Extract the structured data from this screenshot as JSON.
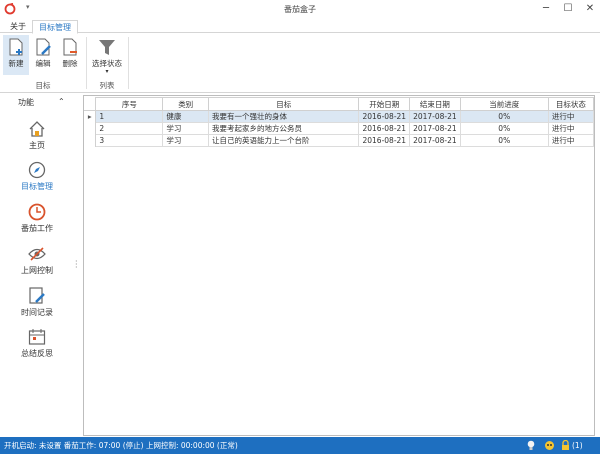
{
  "window": {
    "title": "番茄盒子",
    "minimize": "─",
    "maximize": "☐",
    "close": "✕",
    "quick_access": "▾"
  },
  "tabs": [
    {
      "label": "关于"
    },
    {
      "label": "目标管理",
      "active": true
    }
  ],
  "ribbon": {
    "groups": [
      {
        "label": "目标",
        "buttons": [
          {
            "label": "新建",
            "icon": "new-document-icon",
            "active": true
          },
          {
            "label": "编辑",
            "icon": "edit-document-icon"
          },
          {
            "label": "删除",
            "icon": "delete-document-icon"
          }
        ]
      },
      {
        "label": "列表",
        "buttons": [
          {
            "label": "选择状态",
            "icon": "filter-icon",
            "dropdown": "▾"
          }
        ]
      }
    ]
  },
  "sidebar": {
    "title": "功能",
    "collapse": "⌃",
    "items": [
      {
        "label": "主页",
        "icon": "home-icon"
      },
      {
        "label": "目标管理",
        "icon": "compass-icon",
        "active": true
      },
      {
        "label": "番茄工作",
        "icon": "clock-icon"
      },
      {
        "label": "上网控制",
        "icon": "eye-blocked-icon"
      },
      {
        "label": "时间记录",
        "icon": "time-record-icon"
      },
      {
        "label": "总结反思",
        "icon": "calendar-icon"
      }
    ]
  },
  "grid": {
    "columns": [
      "序号",
      "类别",
      "目标",
      "开始日期",
      "结束日期",
      "当前进度",
      "目标状态"
    ],
    "rows": [
      [
        "1",
        "健康",
        "我要有一个强壮的身体",
        "2016-08-21",
        "2017-08-21",
        "0%",
        "进行中"
      ],
      [
        "2",
        "学习",
        "我要考起家乡的地方公务员",
        "2016-08-21",
        "2017-08-21",
        "0%",
        "进行中"
      ],
      [
        "3",
        "学习",
        "让自己的英语能力上一个台阶",
        "2016-08-21",
        "2017-08-21",
        "0%",
        "进行中"
      ]
    ],
    "selected_row": 0,
    "row_indicator": "▸"
  },
  "status": {
    "text": "开机启动: 未设置   番茄工作: 07:00 (停止)   上网控制: 00:00:00 (正常)",
    "lock_count": "(1)"
  },
  "colors": {
    "accent": "#2b79c4",
    "status_bar": "#1e6fc0",
    "selection": "#dbe7f3"
  }
}
